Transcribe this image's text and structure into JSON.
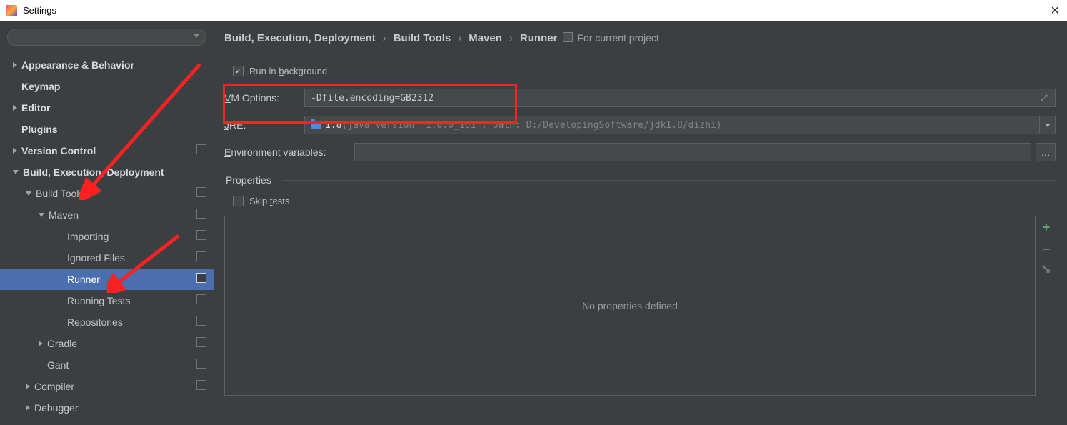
{
  "window": {
    "title": "Settings"
  },
  "search_placeholder": "",
  "sidebar": [
    {
      "label": "Appearance & Behavior",
      "depth": 0,
      "arrow": "collapsed",
      "bold": true,
      "copy": false
    },
    {
      "label": "Keymap",
      "depth": 0,
      "arrow": "none",
      "bold": true,
      "copy": false
    },
    {
      "label": "Editor",
      "depth": 0,
      "arrow": "collapsed",
      "bold": true,
      "copy": false
    },
    {
      "label": "Plugins",
      "depth": 0,
      "arrow": "none",
      "bold": true,
      "copy": false
    },
    {
      "label": "Version Control",
      "depth": 0,
      "arrow": "collapsed",
      "bold": true,
      "copy": true
    },
    {
      "label": "Build, Execution, Deployment",
      "depth": 0,
      "arrow": "expanded",
      "bold": true,
      "copy": false
    },
    {
      "label": "Build Tools",
      "depth": 1,
      "arrow": "expanded",
      "bold": false,
      "copy": true
    },
    {
      "label": "Maven",
      "depth": 2,
      "arrow": "expanded",
      "bold": false,
      "copy": true
    },
    {
      "label": "Importing",
      "depth": 3,
      "arrow": "none",
      "bold": false,
      "copy": true
    },
    {
      "label": "Ignored Files",
      "depth": 3,
      "arrow": "none",
      "bold": false,
      "copy": true
    },
    {
      "label": "Runner",
      "depth": 3,
      "arrow": "none",
      "bold": false,
      "copy": true,
      "selected": true
    },
    {
      "label": "Running Tests",
      "depth": 3,
      "arrow": "none",
      "bold": false,
      "copy": true
    },
    {
      "label": "Repositories",
      "depth": 3,
      "arrow": "none",
      "bold": false,
      "copy": true
    },
    {
      "label": "Gradle",
      "depth": 2,
      "arrow": "collapsed",
      "bold": false,
      "copy": true
    },
    {
      "label": "Gant",
      "depth": 2,
      "arrow": "none",
      "bold": false,
      "copy": true
    },
    {
      "label": "Compiler",
      "depth": 1,
      "arrow": "collapsed",
      "bold": false,
      "copy": true
    },
    {
      "label": "Debugger",
      "depth": 1,
      "arrow": "collapsed",
      "bold": false,
      "copy": false
    }
  ],
  "breadcrumbs": {
    "items": [
      "Build, Execution, Deployment",
      "Build Tools",
      "Maven",
      "Runner"
    ],
    "scope": "For current project"
  },
  "form": {
    "run_bg": {
      "label_pre": "Run in ",
      "mn": "b",
      "label_post": "ackground",
      "checked": true
    },
    "vm_label_pre": "",
    "vm_mn": "V",
    "vm_label_post": "M Options:",
    "vm_value": "-Dfile.encoding=GB2312",
    "jre_label_pre": "",
    "jre_mn": "J",
    "jre_label_post": "RE:",
    "jre_strong": "1.8 ",
    "jre_dim": "(java version \"1.8.0_181\", path: D:/DevelopingSoftware/jdk1.8/dizhi)",
    "env_label_pre": "",
    "env_mn": "E",
    "env_label_post": "nvironment variables:",
    "env_value": "",
    "properties_heading": "Properties",
    "skip_label_pre": "Skip ",
    "skip_mn": "t",
    "skip_label_post": "ests",
    "skip_checked": false,
    "properties_empty": "No properties defined"
  }
}
